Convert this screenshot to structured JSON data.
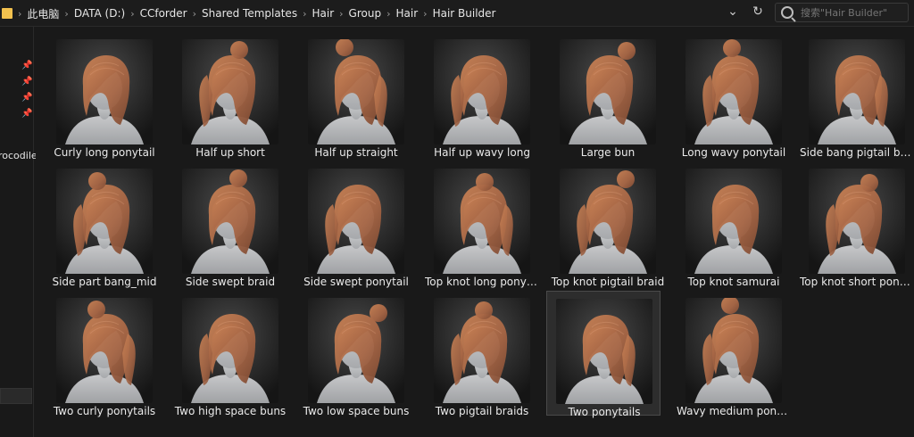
{
  "address": {
    "crumbs": [
      "此电脑",
      "DATA (D:)",
      "CCforder",
      "Shared Templates",
      "Hair",
      "Group",
      "Hair",
      "Hair Builder"
    ],
    "refresh_label": "↻",
    "dropdown_label": "⌄"
  },
  "search": {
    "placeholder": "搜索\"Hair Builder\""
  },
  "nav": {
    "items": [
      "rocodile"
    ]
  },
  "items": [
    "Curly long ponytail",
    "Half up short",
    "Half up straight",
    "Half up wavy long",
    "Large bun",
    "Long wavy ponytail",
    "Side bang pigtail braid",
    "Side part bang_mid",
    "Side swept braid",
    "Side swept ponytail",
    "Top knot long ponytail",
    "Top knot pigtail braid",
    "Top knot samurai",
    "Top knot short ponytail",
    "Two curly ponytails",
    "Two high space buns",
    "Two low space buns",
    "Two pigtail braids",
    "Two ponytails",
    "Wavy medium ponytail"
  ],
  "selected_index": 18,
  "colors": {
    "background": "#191919",
    "hair": "#c98255",
    "skin": "#cfd0d2"
  }
}
